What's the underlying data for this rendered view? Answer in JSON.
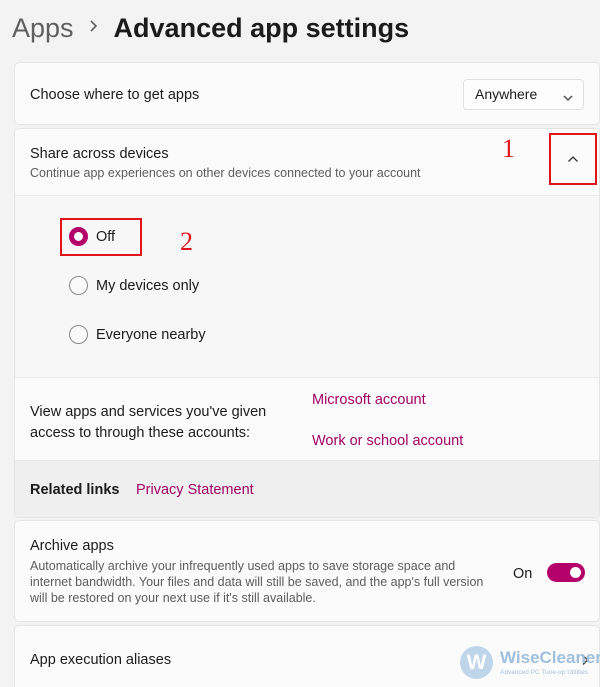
{
  "breadcrumb": {
    "root": "Apps",
    "title": "Advanced app settings"
  },
  "choose": {
    "label": "Choose where to get apps",
    "dropdown_value": "Anywhere"
  },
  "share": {
    "title": "Share across devices",
    "description": "Continue app experiences on other devices connected to your account",
    "options": [
      {
        "label": "Off",
        "checked": true
      },
      {
        "label": "My devices only",
        "checked": false
      },
      {
        "label": "Everyone nearby",
        "checked": false
      }
    ],
    "accounts_text": "View apps and services you've given access to through these accounts:",
    "account_links": [
      "Microsoft account",
      "Work or school account"
    ],
    "related_label": "Related links",
    "related_link": "Privacy Statement"
  },
  "annotations": {
    "step1": "1",
    "step2": "2"
  },
  "archive": {
    "title": "Archive apps",
    "description": "Automatically archive your infrequently used apps to save storage space and internet bandwidth. Your files and data will still be saved, and the app's full version will be restored on your next use if it's still available.",
    "toggle_label": "On",
    "toggle_on": true
  },
  "alias": {
    "title": "App execution aliases"
  },
  "watermark": {
    "logo_letter": "W",
    "name": "WiseCleaner",
    "tagline": "Advanced PC Tune-up Utilities"
  },
  "colors": {
    "accent": "#b4006a",
    "link": "#a10064",
    "annotation": "#e0151b"
  },
  "icons": {
    "breadcrumb_separator": "chevron-right-icon",
    "dropdown": "chevron-down-icon",
    "expand": "chevron-up-icon",
    "alias": "chevron-right-icon"
  }
}
